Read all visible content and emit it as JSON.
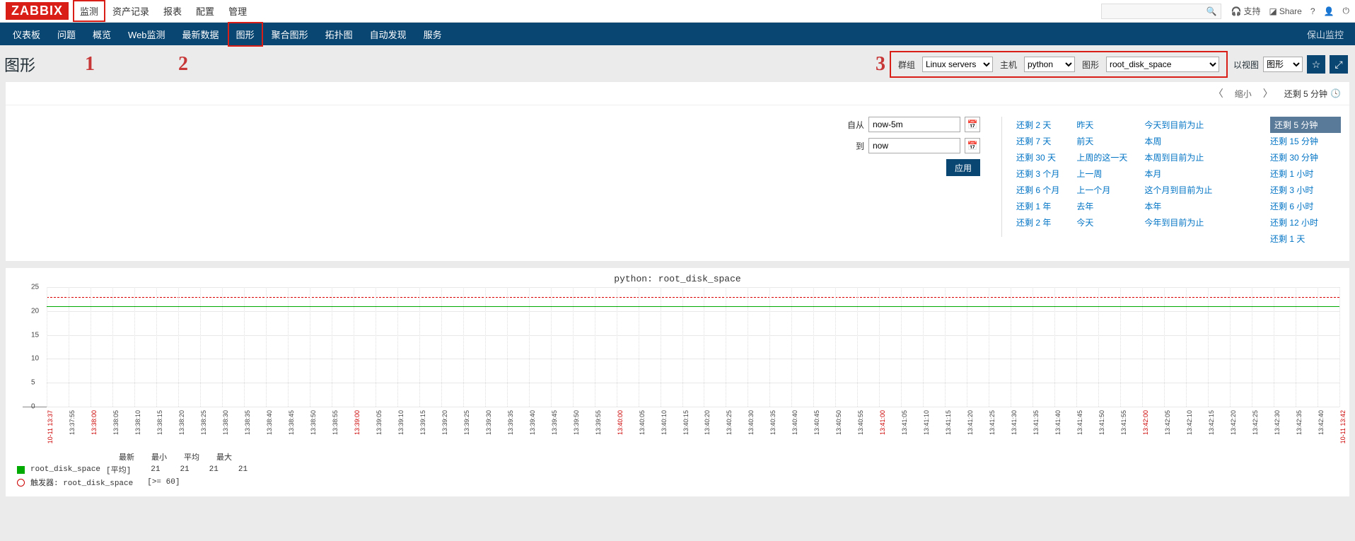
{
  "brand": "ZABBIX",
  "topmenu": [
    "监测",
    "资产记录",
    "报表",
    "配置",
    "管理"
  ],
  "topright": {
    "support": "支持",
    "share": "Share"
  },
  "submenu": [
    "仪表板",
    "问题",
    "概览",
    "Web监测",
    "最新数据",
    "图形",
    "聚合图形",
    "拓扑图",
    "自动发现",
    "服务"
  ],
  "submenu_right": "保山监控",
  "page_title": "图形",
  "annotations": {
    "n1": "1",
    "n2": "2",
    "n3": "3"
  },
  "filters": {
    "group_label": "群组",
    "group_value": "Linux servers",
    "host_label": "主机",
    "host_value": "python",
    "graph_label": "图形",
    "graph_value": "root_disk_space",
    "view_label": "以视图",
    "view_value": "图形"
  },
  "timenav": {
    "zoom_out": "缩小",
    "remaining": "还剩 5 分钟"
  },
  "time_filter": {
    "from_label": "自从",
    "from_value": "now-5m",
    "to_label": "到",
    "to_value": "now",
    "apply": "应用"
  },
  "quick_ranges_col1": [
    "还剩 2 天",
    "还剩 7 天",
    "还剩 30 天",
    "还剩 3 个月",
    "还剩 6 个月",
    "还剩 1 年",
    "还剩 2 年"
  ],
  "quick_ranges_col2": [
    "昨天",
    "前天",
    "上周的这一天",
    "上一周",
    "上一个月",
    "去年"
  ],
  "quick_ranges_col3": [
    "今天",
    "今天到目前为止",
    "本周",
    "本周到目前为止",
    "本月",
    "这个月到目前为止",
    "本年",
    "今年到目前为止"
  ],
  "quick_ranges_col4": [
    "还剩 5 分钟",
    "还剩 15 分钟",
    "还剩 30 分钟",
    "还剩 1 小时",
    "还剩 3 小时",
    "还剩 6 小时",
    "还剩 12 小时",
    "还剩 1 天"
  ],
  "quick_selected": "还剩 5 分钟",
  "chart_data": {
    "type": "line",
    "title": "python: root_disk_space",
    "ylim": [
      0,
      25
    ],
    "yticks": [
      0,
      5,
      10,
      15,
      20,
      25
    ],
    "x_ticks": [
      "10-11 13:37",
      "13:37:55",
      "13:38:00",
      "13:38:05",
      "13:38:10",
      "13:38:15",
      "13:38:20",
      "13:38:25",
      "13:38:30",
      "13:38:35",
      "13:38:40",
      "13:38:45",
      "13:38:50",
      "13:38:55",
      "13:39:00",
      "13:39:05",
      "13:39:10",
      "13:39:15",
      "13:39:20",
      "13:39:25",
      "13:39:30",
      "13:39:35",
      "13:39:40",
      "13:39:45",
      "13:39:50",
      "13:39:55",
      "13:40:00",
      "13:40:05",
      "13:40:10",
      "13:40:15",
      "13:40:20",
      "13:40:25",
      "13:40:30",
      "13:40:35",
      "13:40:40",
      "13:40:45",
      "13:40:50",
      "13:40:55",
      "13:41:00",
      "13:41:05",
      "13:41:10",
      "13:41:15",
      "13:41:20",
      "13:41:25",
      "13:41:30",
      "13:41:35",
      "13:41:40",
      "13:41:45",
      "13:41:50",
      "13:41:55",
      "13:42:00",
      "13:42:05",
      "13:42:10",
      "13:42:15",
      "13:42:20",
      "13:42:25",
      "13:42:30",
      "13:42:35",
      "13:42:40",
      "10-11 13:42"
    ],
    "x_red_labels": [
      "10-11 13:37",
      "13:38:00",
      "13:39:00",
      "13:40:00",
      "13:41:00",
      "13:42:00",
      "10-11 13:42"
    ],
    "series": [
      {
        "name": "root_disk_space",
        "constant_value": 21
      }
    ],
    "trigger_line": 23
  },
  "legend": {
    "headers": [
      "最新",
      "最小",
      "平均",
      "最大"
    ],
    "metric_name": "root_disk_space",
    "metric_tag": "[平均]",
    "values": [
      "21",
      "21",
      "21",
      "21"
    ],
    "trigger_label": "触发器: root_disk_space",
    "trigger_cond": "[>= 60]"
  }
}
